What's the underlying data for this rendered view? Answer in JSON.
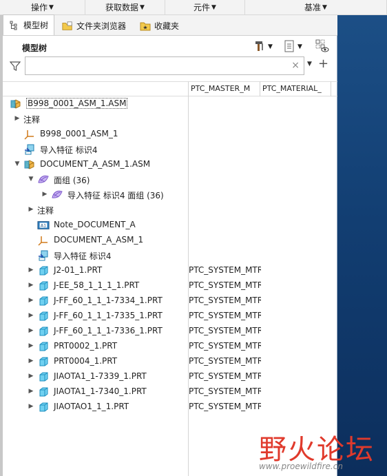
{
  "top_menu": [
    {
      "label": "操作",
      "has_caret": true
    },
    {
      "label": "获取数据",
      "has_caret": true
    },
    {
      "label": "元件",
      "has_caret": true
    },
    {
      "label": "基准",
      "has_caret": true
    }
  ],
  "tabs": [
    {
      "label": "模型树",
      "icon": "tree-icon",
      "active": true
    },
    {
      "label": "文件夹浏览器",
      "icon": "folder-browser-icon",
      "active": false
    },
    {
      "label": "收藏夹",
      "icon": "favorites-icon",
      "active": false
    }
  ],
  "tree": {
    "title": "模型树",
    "search": {
      "value": "",
      "placeholder": ""
    },
    "columns": [
      "PTC_MASTER_M",
      "PTC_MATERIAL_"
    ],
    "rows": [
      {
        "label": "B998_0001_ASM_1.ASM",
        "icon": "assembly-icon",
        "level": 0,
        "toggle": "",
        "col1": ""
      },
      {
        "label": "注释",
        "icon": "",
        "level": 0,
        "toggle": "▶",
        "col1": ""
      },
      {
        "label": "B998_0001_ASM_1",
        "icon": "csys-icon",
        "level": 1,
        "toggle": "",
        "col1": ""
      },
      {
        "label": "导入特征 标识4",
        "icon": "import-feature-icon",
        "level": 1,
        "toggle": "",
        "col1": ""
      },
      {
        "label": "DOCUMENT_A_ASM_1.ASM",
        "icon": "assembly-icon",
        "level": 0,
        "toggle": "▼",
        "col1": ""
      },
      {
        "label": "面组 (36)",
        "icon": "quilt-icon",
        "level": 1,
        "toggle": "▼",
        "col1": ""
      },
      {
        "label": "导入特征 标识4 面组 (36)",
        "icon": "quilt-icon",
        "level": 2,
        "toggle": "▶",
        "col1": ""
      },
      {
        "label": "注释",
        "icon": "",
        "level": 1,
        "toggle": "▶",
        "col1": ""
      },
      {
        "label": "Note_DOCUMENT_A",
        "icon": "note-icon",
        "level": 2,
        "toggle": "",
        "col1": ""
      },
      {
        "label": "DOCUMENT_A_ASM_1",
        "icon": "csys-icon",
        "level": 2,
        "toggle": "",
        "col1": ""
      },
      {
        "label": "导入特征 标识4",
        "icon": "import-feature-icon",
        "level": 2,
        "toggle": "",
        "col1": ""
      },
      {
        "label": "J2-01_1.PRT",
        "icon": "part-icon",
        "level": 1,
        "toggle": "▶",
        "col1": "PTC_SYSTEM_MTRL"
      },
      {
        "label": "J-EE_58_1_1_1_1.PRT",
        "icon": "part-icon",
        "level": 1,
        "toggle": "▶",
        "col1": "PTC_SYSTEM_MTRL"
      },
      {
        "label": "J-FF_60_1_1_1-7334_1.PRT",
        "icon": "part-icon",
        "level": 1,
        "toggle": "▶",
        "col1": "PTC_SYSTEM_MTRL"
      },
      {
        "label": "J-FF_60_1_1_1-7335_1.PRT",
        "icon": "part-icon",
        "level": 1,
        "toggle": "▶",
        "col1": "PTC_SYSTEM_MTRL"
      },
      {
        "label": "J-FF_60_1_1_1-7336_1.PRT",
        "icon": "part-icon",
        "level": 1,
        "toggle": "▶",
        "col1": "PTC_SYSTEM_MTRL"
      },
      {
        "label": "PRT0002_1.PRT",
        "icon": "part-icon",
        "level": 1,
        "toggle": "▶",
        "col1": "PTC_SYSTEM_MTRL"
      },
      {
        "label": "PRT0004_1.PRT",
        "icon": "part-icon",
        "level": 1,
        "toggle": "▶",
        "col1": "PTC_SYSTEM_MTRL"
      },
      {
        "label": "JIAOTA1_1-7339_1.PRT",
        "icon": "part-icon",
        "level": 1,
        "toggle": "▶",
        "col1": "PTC_SYSTEM_MTRL"
      },
      {
        "label": "JIAOTA1_1-7340_1.PRT",
        "icon": "part-icon",
        "level": 1,
        "toggle": "▶",
        "col1": "PTC_SYSTEM_MTRL"
      },
      {
        "label": "JIAOTAO1_1_1.PRT",
        "icon": "part-icon",
        "level": 1,
        "toggle": "▶",
        "col1": "PTC_SYSTEM_MTRL"
      }
    ]
  },
  "watermark": {
    "text": "野火论坛",
    "url": "www.proewildfire.cn"
  },
  "colors": {
    "accent": "#1c4f86",
    "part": "#38b8e0",
    "quilt": "#8a6bd1",
    "watermark": "#e03a2c"
  }
}
